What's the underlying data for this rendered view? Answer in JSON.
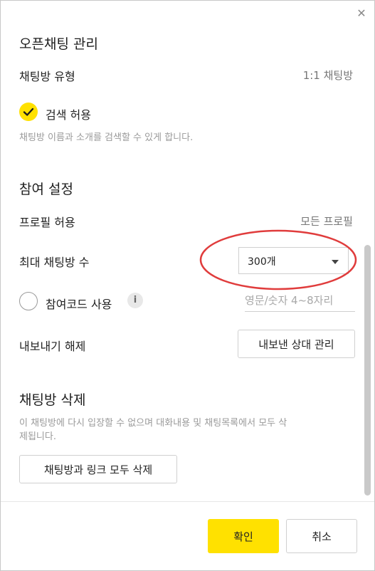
{
  "close_icon": "✕",
  "open_chat": {
    "title": "오픈채팅 관리",
    "room_type_label": "채팅방 유형",
    "room_type_value": "1:1 채팅방",
    "search_allow_label": "검색 허용",
    "search_allow_checked": true,
    "search_allow_desc": "채팅방 이름과 소개를 검색할 수 있게 합니다."
  },
  "participation": {
    "title": "참여 설정",
    "profile_label": "프로필 허용",
    "profile_value": "모든 프로필",
    "max_label": "최대 채팅방 수",
    "max_value": "300개",
    "code_label": "참여코드 사용",
    "code_checked": false,
    "info_icon": "i",
    "code_placeholder": "영문/숫자 4~8자리",
    "export_label": "내보내기 해제",
    "export_button": "내보낸 상대 관리"
  },
  "delete": {
    "title": "채팅방 삭제",
    "desc_line1": "이 채팅방에 다시 입장할 수 없으며 대화내용 및 채팅목록에서 모두 삭",
    "desc_line2": "제됩니다.",
    "button": "채팅방과 링크 모두 삭제"
  },
  "footer": {
    "confirm": "확인",
    "cancel": "취소"
  },
  "colors": {
    "accent": "#ffe100",
    "annotation": "#e03c3c"
  }
}
